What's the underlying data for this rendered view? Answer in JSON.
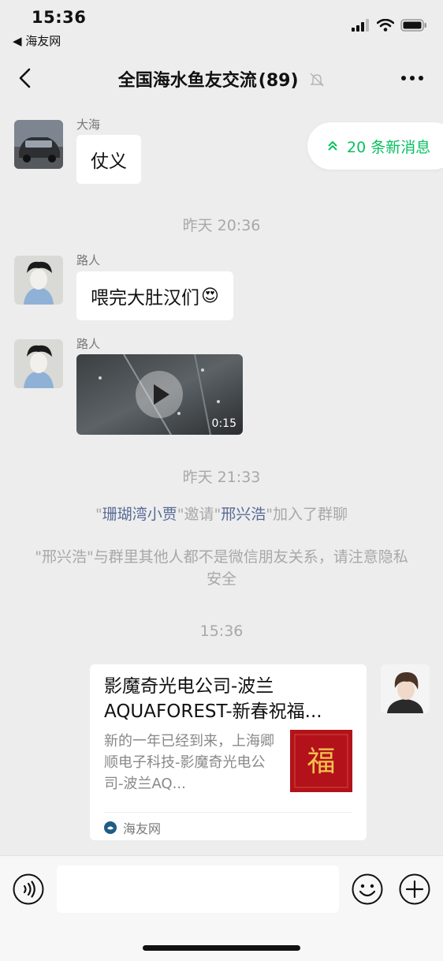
{
  "status_bar": {
    "time": "15:36",
    "back_app": "◀ 海友网"
  },
  "nav": {
    "title": "全国海水鱼友交流",
    "member_count": "(89)",
    "icons": [
      "chevron-left-icon",
      "bell-mute-icon",
      "more-dots-icon"
    ]
  },
  "new_messages": {
    "label": "20 条新消息",
    "color": "#07c160"
  },
  "messages": [
    {
      "sender": "大海",
      "text": "仗义"
    },
    {
      "time": "昨天 20:36"
    },
    {
      "sender": "路人",
      "text": "喂完大肚汉们",
      "emoji": "😍"
    },
    {
      "sender": "路人",
      "video_duration": "0:15"
    },
    {
      "time": "昨天 21:33"
    },
    {
      "system": {
        "q1": "\"",
        "inviter": "珊瑚湾小贾",
        "q2": "\"邀请\"",
        "invitee": "邢兴浩",
        "q3": "\"加入了群聊"
      }
    },
    {
      "system_text": "\"邢兴浩\"与群里其他人都不是微信朋友关系，请注意隐私安全"
    },
    {
      "time": "15:36"
    },
    {
      "link_card": {
        "title": "影魔奇光电公司-波兰AQUAFOREST-新春祝福...",
        "description": "新的一年已经到来，上海卿顺电子科技-影魔奇光电公司-波兰AQ...",
        "thumb_text": "福",
        "source": "海友网"
      }
    }
  ],
  "input_bar": {
    "placeholder": "",
    "icons": [
      "voice-icon",
      "emoji-icon",
      "plus-icon"
    ]
  },
  "colors": {
    "background": "#ededed",
    "link_blue": "#576b95",
    "accent_green": "#07c160"
  }
}
